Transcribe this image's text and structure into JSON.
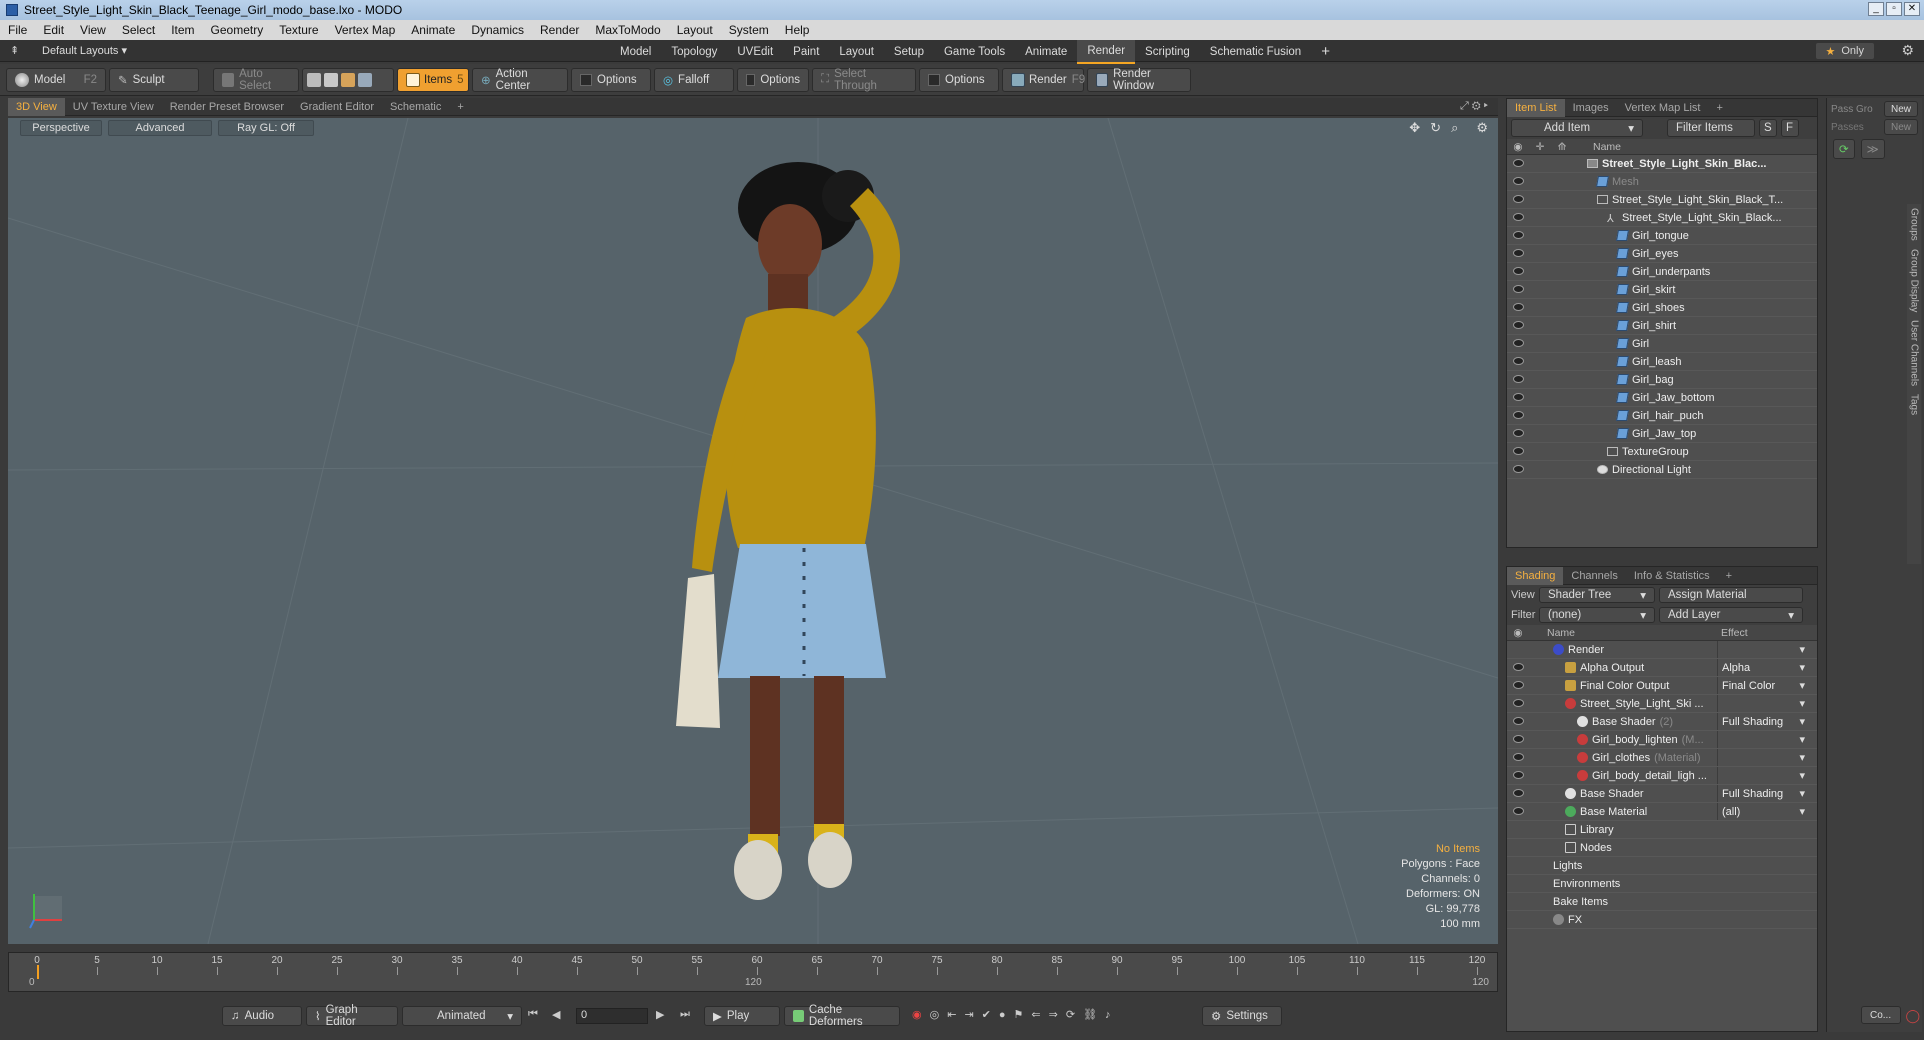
{
  "window": {
    "title": "Street_Style_Light_Skin_Black_Teenage_Girl_modo_base.lxo - MODO"
  },
  "menu": [
    "File",
    "Edit",
    "View",
    "Select",
    "Item",
    "Geometry",
    "Texture",
    "Vertex Map",
    "Animate",
    "Dynamics",
    "Render",
    "MaxToModo",
    "Layout",
    "System",
    "Help"
  ],
  "layout": {
    "preset": "Default Layouts",
    "tabs": [
      "Model",
      "Topology",
      "UVEdit",
      "Paint",
      "Layout",
      "Setup",
      "Game Tools",
      "Animate",
      "Render",
      "Scripting",
      "Schematic Fusion"
    ],
    "active_tab": "Render",
    "only_label": "Only"
  },
  "toolbar": {
    "model": "Model",
    "model_key": "F2",
    "sculpt": "Sculpt",
    "auto_select": "Auto Select",
    "items": "Items",
    "items_key": "5",
    "action_center": "Action Center",
    "options1": "Options",
    "falloff": "Falloff",
    "options2": "Options",
    "select_through": "Select Through",
    "options3": "Options",
    "render": "Render",
    "render_key": "F9",
    "render_window": "Render Window"
  },
  "viewport_tabs": [
    "3D View",
    "UV Texture View",
    "Render Preset Browser",
    "Gradient Editor",
    "Schematic"
  ],
  "viewport": {
    "perspective": "Perspective",
    "advanced": "Advanced",
    "raygl": "Ray GL: Off",
    "info": {
      "no_items": "No Items",
      "polygons": "Polygons : Face",
      "channels": "Channels: 0",
      "deformers": "Deformers: ON",
      "gl": "GL: 99,778",
      "scale": "100 mm"
    }
  },
  "timeline": {
    "ticks": [
      "0",
      "5",
      "10",
      "15",
      "20",
      "25",
      "30",
      "35",
      "40",
      "45",
      "50",
      "55",
      "60",
      "65",
      "70",
      "75",
      "80",
      "85",
      "90",
      "95",
      "100",
      "105",
      "110",
      "115",
      "120"
    ],
    "start": "0",
    "mid": "120",
    "end": "120"
  },
  "bottom": {
    "audio": "Audio",
    "graph_editor": "Graph Editor",
    "animated": "Animated",
    "frame": "0",
    "play": "Play",
    "cache_deformers": "Cache Deformers",
    "settings": "Settings"
  },
  "item_list": {
    "tabs": [
      "Item List",
      "Images",
      "Vertex Map List"
    ],
    "add_item": "Add Item",
    "filter_items": "Filter Items",
    "s": "S",
    "f": "F",
    "col_name": "Name",
    "rows": [
      {
        "label": "Street_Style_Light_Skin_Blac...",
        "indent": 0,
        "icon": "scene",
        "bold": true
      },
      {
        "label": "Mesh",
        "indent": 1,
        "icon": "mesh",
        "dim": true
      },
      {
        "label": "Street_Style_Light_Skin_Black_T...",
        "indent": 1,
        "icon": "group"
      },
      {
        "label": "Street_Style_Light_Skin_Black...",
        "indent": 2,
        "icon": "locator"
      },
      {
        "label": "Girl_tongue",
        "indent": 3,
        "icon": "mesh"
      },
      {
        "label": "Girl_eyes",
        "indent": 3,
        "icon": "mesh"
      },
      {
        "label": "Girl_underpants",
        "indent": 3,
        "icon": "mesh"
      },
      {
        "label": "Girl_skirt",
        "indent": 3,
        "icon": "mesh"
      },
      {
        "label": "Girl_shoes",
        "indent": 3,
        "icon": "mesh"
      },
      {
        "label": "Girl_shirt",
        "indent": 3,
        "icon": "mesh"
      },
      {
        "label": "Girl",
        "indent": 3,
        "icon": "mesh"
      },
      {
        "label": "Girl_leash",
        "indent": 3,
        "icon": "mesh"
      },
      {
        "label": "Girl_bag",
        "indent": 3,
        "icon": "mesh"
      },
      {
        "label": "Girl_Jaw_bottom",
        "indent": 3,
        "icon": "mesh"
      },
      {
        "label": "Girl_hair_puch",
        "indent": 3,
        "icon": "mesh"
      },
      {
        "label": "Girl_Jaw_top",
        "indent": 3,
        "icon": "mesh"
      },
      {
        "label": "TextureGroup",
        "indent": 2,
        "icon": "group"
      },
      {
        "label": "Directional Light",
        "indent": 1,
        "icon": "light"
      }
    ]
  },
  "shading": {
    "tabs": [
      "Shading",
      "Channels",
      "Info & Statistics"
    ],
    "view_label": "View",
    "view_value": "Shader Tree",
    "assign_material": "Assign Material",
    "filter_label": "Filter",
    "filter_value": "(none)",
    "add_layer": "Add Layer",
    "col_name": "Name",
    "col_effect": "Effect",
    "rows": [
      {
        "label": "Render",
        "indent": 0,
        "icon": "render",
        "effect": "",
        "eye": false
      },
      {
        "label": "Alpha Output",
        "indent": 1,
        "icon": "output",
        "effect": "Alpha",
        "eye": true
      },
      {
        "label": "Final Color Output",
        "indent": 1,
        "icon": "output",
        "effect": "Final Color",
        "eye": true
      },
      {
        "label": "Street_Style_Light_Ski ...",
        "indent": 1,
        "icon": "mat-red",
        "effect": "",
        "eye": true
      },
      {
        "label": "Base Shader",
        "suffix": "(2)",
        "indent": 2,
        "icon": "shader",
        "effect": "Full Shading",
        "eye": true
      },
      {
        "label": "Girl_body_lighten",
        "suffix": "(M...",
        "indent": 2,
        "icon": "mat-red",
        "effect": "",
        "eye": true
      },
      {
        "label": "Girl_clothes",
        "suffix": "(Material)",
        "indent": 2,
        "icon": "mat-red",
        "effect": "",
        "eye": true
      },
      {
        "label": "Girl_body_detail_ligh ...",
        "indent": 2,
        "icon": "mat-red",
        "effect": "",
        "eye": true
      },
      {
        "label": "Base Shader",
        "indent": 1,
        "icon": "shader",
        "effect": "Full Shading",
        "eye": true
      },
      {
        "label": "Base Material",
        "indent": 1,
        "icon": "mat-green",
        "effect": "(all)",
        "eye": true
      },
      {
        "label": "Library",
        "indent": 1,
        "icon": "folder",
        "effect": "",
        "eye": false,
        "noDrop": true
      },
      {
        "label": "Nodes",
        "indent": 1,
        "icon": "folder",
        "effect": "",
        "eye": false,
        "noDrop": true
      },
      {
        "label": "Lights",
        "indent": 0,
        "icon": "none",
        "effect": "",
        "eye": false,
        "noDrop": true
      },
      {
        "label": "Environments",
        "indent": 0,
        "icon": "none",
        "effect": "",
        "eye": false,
        "noDrop": true
      },
      {
        "label": "Bake Items",
        "indent": 0,
        "icon": "none",
        "effect": "",
        "eye": false,
        "noDrop": true
      },
      {
        "label": "FX",
        "indent": 0,
        "icon": "fx",
        "effect": "",
        "eye": false,
        "noDrop": true
      }
    ]
  },
  "pass_panel": {
    "pass_label": "Pass Gro",
    "passes_label": "Passes",
    "new1": "New",
    "new2": "New",
    "co": "Co...",
    "side_tabs": [
      "Groups",
      "Group Display",
      "User Channels",
      "Tags"
    ]
  }
}
